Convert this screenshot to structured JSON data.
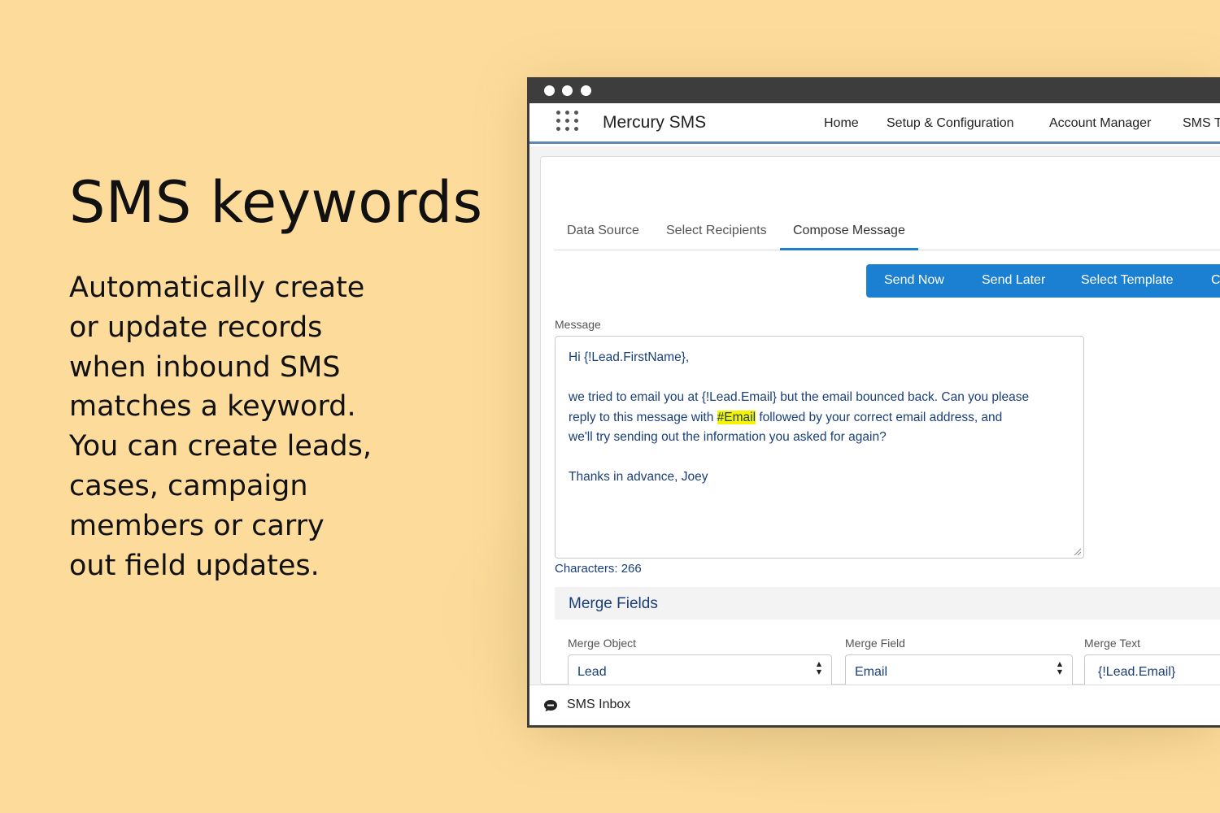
{
  "hero": {
    "headline": "SMS keywords",
    "description_lines": [
      "Automatically create",
      "or update records",
      "when inbound SMS",
      "matches a keyword.",
      "You can create leads,",
      "cases, campaign",
      "members or carry",
      "out field updates."
    ]
  },
  "app": {
    "name": "Mercury SMS",
    "launcher_icon": "app-launcher-grid-icon",
    "nav": [
      "Home",
      "Setup & Configuration",
      "Account Manager",
      "SMS Te"
    ]
  },
  "tabs": [
    {
      "label": "Data Source",
      "active": false
    },
    {
      "label": "Select Recipients",
      "active": false
    },
    {
      "label": "Compose Message",
      "active": true
    }
  ],
  "actions": [
    "Send Now",
    "Send Later",
    "Select Template",
    "Ca"
  ],
  "message": {
    "label": "Message",
    "line1": "Hi {!Lead.FirstName},",
    "line2": "we tried to email you at {!Lead.Email} but the email bounced back. Can you please",
    "line3_before": "reply to this message with ",
    "line3_keyword": "#Email",
    "line3_after": " followed by your correct email address, and",
    "line4": "we'll try sending out the information you asked for again?",
    "line5": "Thanks in advance, Joey",
    "char_count": "Characters: 266"
  },
  "merge": {
    "title": "Merge Fields",
    "object_label": "Merge Object",
    "object_value": "Lead",
    "field_label": "Merge Field",
    "field_value": "Email",
    "text_label": "Merge Text",
    "text_value": "{!Lead.Email}"
  },
  "footer": {
    "label": "SMS Inbox",
    "icon": "sms-chat-icon"
  },
  "colors": {
    "background": "#fddc9b",
    "brand_blue": "#1b80d2",
    "highlight": "#f7f300",
    "text_blue": "#1a3f78"
  }
}
